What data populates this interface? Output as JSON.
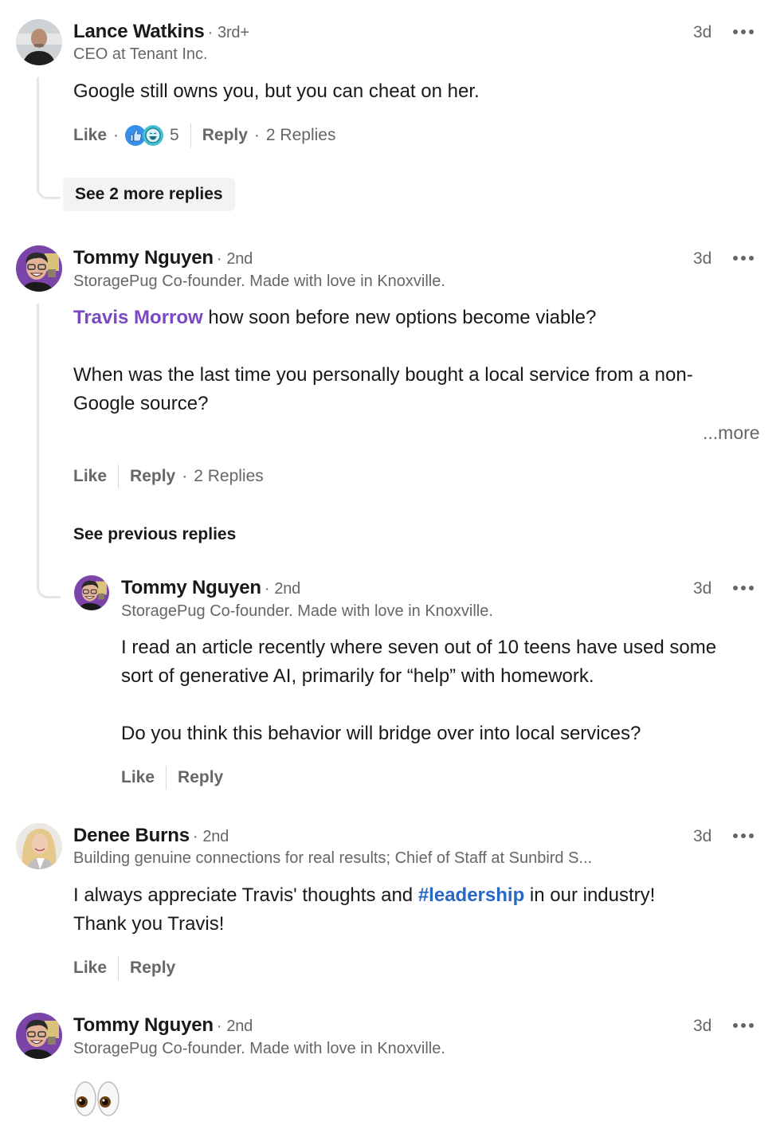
{
  "comments": [
    {
      "author": "Lance Watkins",
      "degree": "3rd+",
      "headline": "CEO at Tenant Inc.",
      "time": "3d",
      "text": "Google still owns you, but you can cheat on her.",
      "like_label": "Like",
      "reactions": [
        "like-icon",
        "funny-icon"
      ],
      "reaction_count": "5",
      "reply_label": "Reply",
      "replies_count": "2 Replies",
      "see_more_replies": "See 2 more replies"
    },
    {
      "author": "Tommy Nguyen",
      "degree": "2nd",
      "headline": "StoragePug Co-founder. Made with love in Knoxville.",
      "time": "3d",
      "mention": "Travis Morrow",
      "text_line1": "how soon before new options become viable?",
      "text_line2": "When was the last time you personally bought a local service from a non-",
      "text_line3": "Google source?",
      "more_label": "...more",
      "like_label": "Like",
      "reply_label": "Reply",
      "replies_count": "2 Replies",
      "see_previous_replies": "See previous replies",
      "reply": {
        "author": "Tommy Nguyen",
        "degree": "2nd",
        "headline": "StoragePug Co-founder. Made with love in Knoxville.",
        "time": "3d",
        "text_line1": "I read an article recently where seven out of 10 teens have used some",
        "text_line2": "sort of generative AI, primarily for “help” with homework.",
        "text_line3": "Do you think this behavior will bridge over into local services?",
        "like_label": "Like",
        "reply_label": "Reply"
      }
    },
    {
      "author": "Denee Burns",
      "degree": "2nd",
      "headline": "Building genuine connections for real results; Chief of Staff at Sunbird S...",
      "time": "3d",
      "text_pre": "I always appreciate Travis' thoughts and ",
      "hashtag": "#leadership",
      "text_post": " in our industry!",
      "text_line2": "Thank you Travis!",
      "like_label": "Like",
      "reply_label": "Reply"
    },
    {
      "author": "Tommy Nguyen",
      "degree": "2nd",
      "headline": "StoragePug Co-founder. Made with love in Knoxville.",
      "time": "3d",
      "text": "👀"
    }
  ],
  "colors": {
    "mention": "#7a48c4",
    "hashtag": "#2767c5",
    "secondary_text": "#666666",
    "primary_text": "#191919"
  }
}
